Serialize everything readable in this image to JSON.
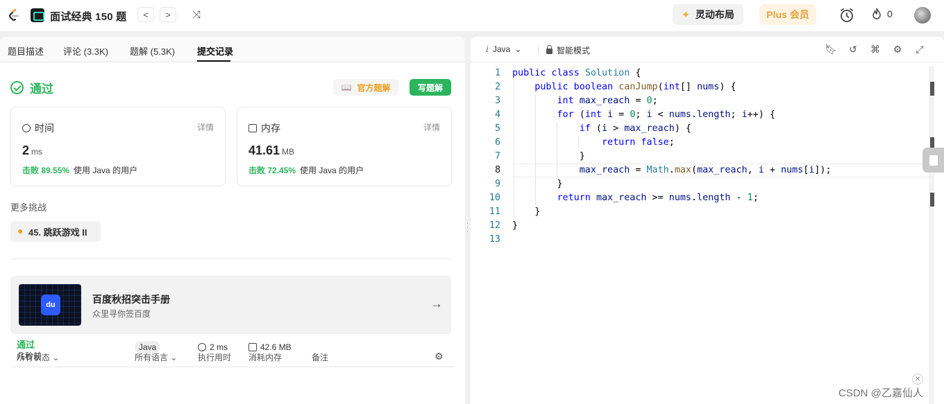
{
  "topbar": {
    "study_title": "面试经典 150 题",
    "prev_label": "<",
    "next_label": ">",
    "layout_label": "灵动布局",
    "plus_label": "Plus 会员",
    "streak_count": "0"
  },
  "tabs": [
    {
      "label": "题目描述"
    },
    {
      "label": "评论 (3.3K)"
    },
    {
      "label": "题解 (5.3K)"
    },
    {
      "label": "提交记录"
    }
  ],
  "result": {
    "status": "通过",
    "official_solution_label": "官方题解",
    "write_solution_label": "写题解"
  },
  "runtime_card": {
    "label": "时间",
    "detail": "详情",
    "value": "2",
    "unit": "ms",
    "beat_pct": "击败 89.55%",
    "beat_text": "使用 Java 的用户"
  },
  "memory_card": {
    "label": "内存",
    "detail": "详情",
    "value": "41.61",
    "unit": "MB",
    "beat_pct": "击败 72.45%",
    "beat_text": "使用 Java 的用户"
  },
  "more": {
    "title": "更多挑战",
    "challenge": "45. 跳跃游戏 II"
  },
  "ad": {
    "logo_text": "du",
    "title": "百度秋招突击手册",
    "subtitle": "众里寻你签百度"
  },
  "table": {
    "headers": [
      "所有状态",
      "所有语言",
      "执行用时",
      "消耗内存",
      "备注"
    ],
    "rows": [
      {
        "status": "通过",
        "time": "几秒前",
        "lang": "Java",
        "runtime": "2 ms",
        "memory": "42.6 MB"
      }
    ]
  },
  "editor": {
    "language": "Java",
    "lang_prefix": "i",
    "mode": "智能模式",
    "current_line": 8,
    "line_numbers": [
      "1",
      "2",
      "3",
      "4",
      "5",
      "6",
      "7",
      "8",
      "9",
      "10",
      "11",
      "12",
      "13"
    ]
  },
  "watermark": "CSDN @乙嘉仙人",
  "colors": {
    "accent_green": "#2db55d",
    "accent_orange": "#f0a020",
    "plus_gold": "#e7a23c"
  }
}
